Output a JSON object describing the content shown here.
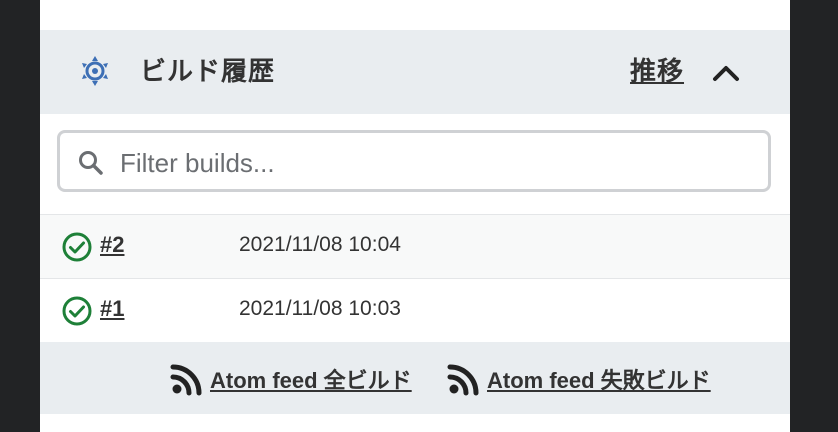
{
  "build_history": {
    "title": "ビルド履歴",
    "trend_link": "推移",
    "icons": {
      "section": "gear-icon",
      "collapse": "chevron-up-icon"
    },
    "search": {
      "placeholder": "Filter builds...",
      "value": ""
    },
    "builds": [
      {
        "number": "#2",
        "timestamp": "2021/11/08 10:04",
        "status": "success"
      },
      {
        "number": "#1",
        "timestamp": "2021/11/08 10:03",
        "status": "success"
      }
    ],
    "feeds": [
      {
        "label": "Atom feed 全ビルド",
        "icon": "rss-icon"
      },
      {
        "label": "Atom feed 失敗ビルド",
        "icon": "rss-icon"
      }
    ]
  },
  "colors": {
    "header_bg": "#e9edf0",
    "success": "#1e8038",
    "gear": "#3d6fb5",
    "text": "#333333",
    "outer_bg": "#222325"
  }
}
